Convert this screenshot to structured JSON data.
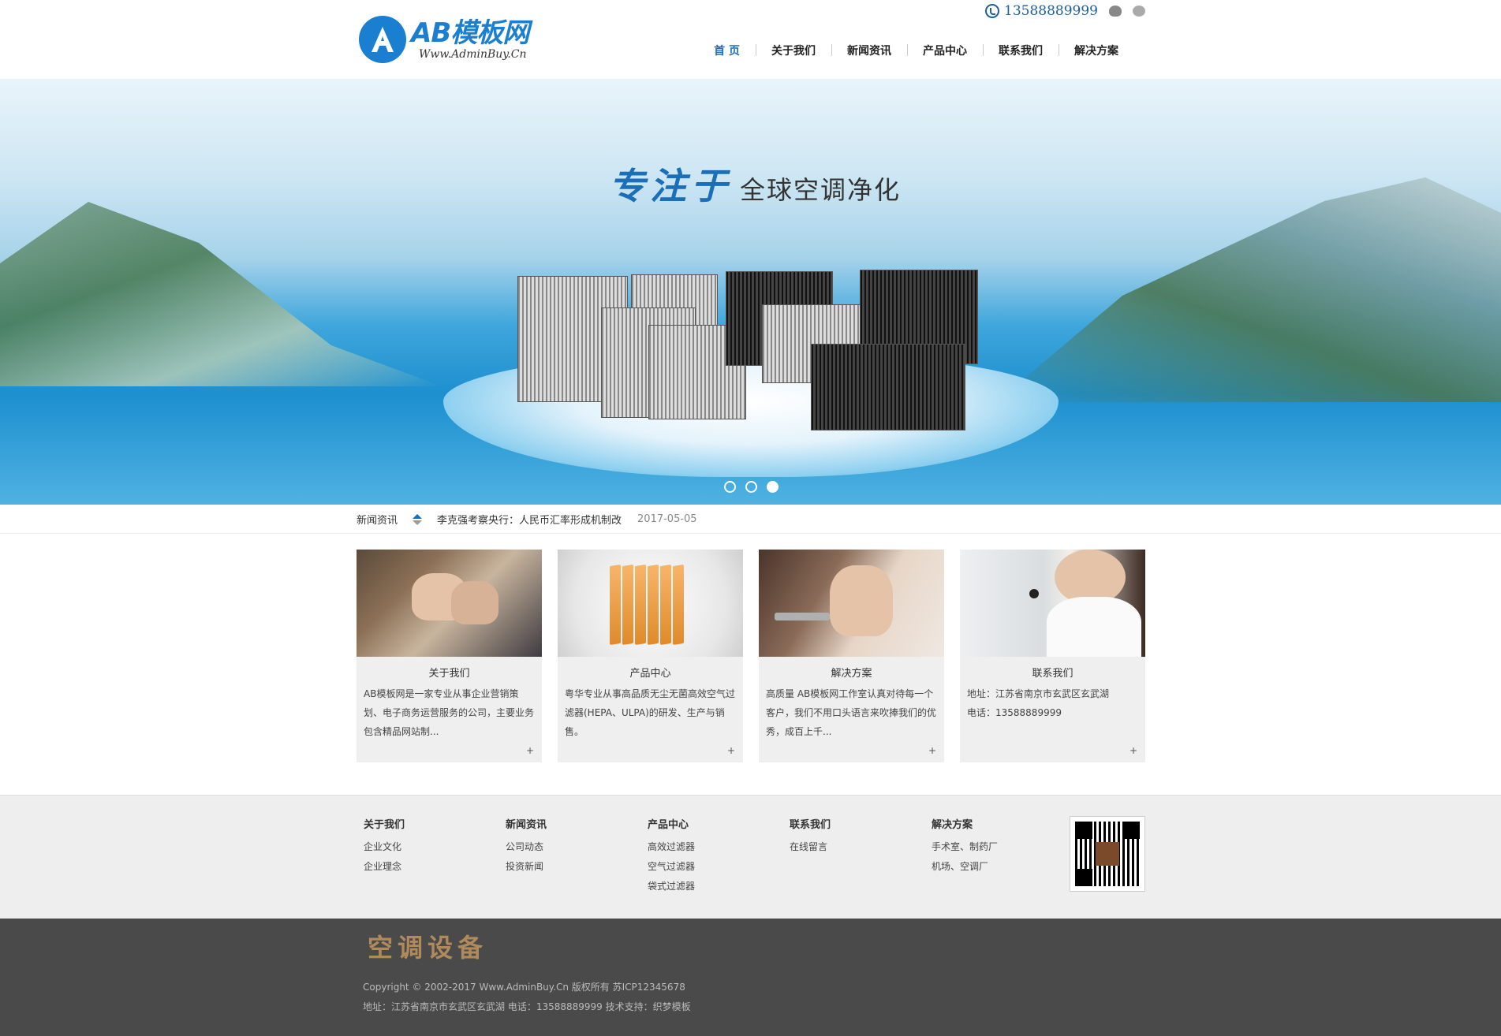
{
  "header": {
    "logo_title": "AB模板网",
    "logo_subtitle": "Www.AdminBuy.Cn",
    "phone": "13588889999",
    "social_icons": [
      "weibo-icon",
      "wechat-icon"
    ],
    "nav": [
      {
        "label": "首 页",
        "active": true
      },
      {
        "label": "关于我们"
      },
      {
        "label": "新闻资讯"
      },
      {
        "label": "产品中心"
      },
      {
        "label": "联系我们"
      },
      {
        "label": "解决方案"
      }
    ],
    "accent_color": "#1a6fb8"
  },
  "banner": {
    "slogan_emphasis": "专注于",
    "slogan_rest": "全球空调净化",
    "slide_count": 3,
    "active_slide": 3
  },
  "ticker": {
    "label": "新闻资讯",
    "headline": "李克强考察央行：人民币汇率形成机制改",
    "date": "2017-05-05"
  },
  "cards": [
    {
      "title": "关于我们",
      "desc": "AB模板网是一家专业从事企业营销策划、电子商务运营服务的公司，主要业务包含精品网站制...",
      "more": "+",
      "icon": "handshake-image"
    },
    {
      "title": "产品中心",
      "desc": "粤华专业从事高品质无尘无菌高效空气过滤器(HEPA、ULPA)的研发、生产与销售。",
      "more": "+",
      "icon": "filter-bag-image"
    },
    {
      "title": "解决方案",
      "desc": "高质量 AB模板网工作室认真对待每一个客户，我们不用口头语言来吹捧我们的优秀，成百上千...",
      "more": "+",
      "icon": "key-hand-image"
    },
    {
      "title": "联系我们",
      "desc": "地址：江苏省南京市玄武区玄武湖\n电话：13588889999",
      "more": "+",
      "icon": "call-center-image"
    }
  ],
  "footer_links": [
    {
      "head": "关于我们",
      "items": [
        "企业文化",
        "企业理念"
      ]
    },
    {
      "head": "新闻资讯",
      "items": [
        "公司动态",
        "投资新闻"
      ]
    },
    {
      "head": "产品中心",
      "items": [
        "高效过滤器",
        "空气过滤器",
        "袋式过滤器"
      ]
    },
    {
      "head": "联系我们",
      "items": [
        "在线留言"
      ]
    },
    {
      "head": "解决方案",
      "items": [
        "手术室、制药厂",
        "机场、空调厂"
      ]
    }
  ],
  "footer_bottom": {
    "brand": "空调设备",
    "copyright": "Copyright © 2002-2017 Www.AdminBuy.Cn 版权所有 苏ICP12345678",
    "address": "地址：江苏省南京市玄武区玄武湖 电话：13588889999 技术支持：织梦模板"
  }
}
